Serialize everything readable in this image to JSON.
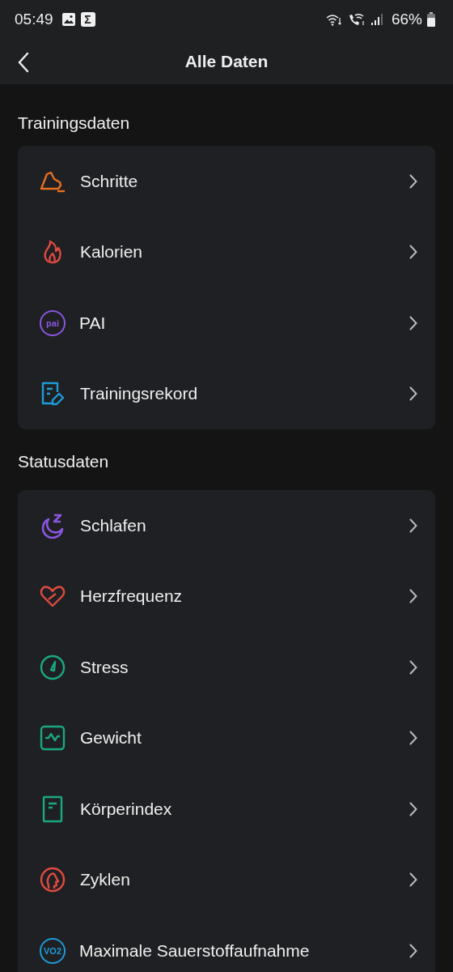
{
  "status_bar": {
    "time": "05:49",
    "notification_badge": "Σ",
    "battery": "66%"
  },
  "header": {
    "title": "Alle Daten"
  },
  "sections": [
    {
      "title": "Trainingsdaten",
      "items": [
        {
          "label": "Schritte",
          "kind": "shoe",
          "color": "#e8701f"
        },
        {
          "label": "Kalorien",
          "kind": "flame",
          "color": "#e04a3f"
        },
        {
          "label": "PAI",
          "kind": "badge",
          "color": "#8a56e0",
          "icon_text": "pai"
        },
        {
          "label": "Trainingsrekord",
          "kind": "record",
          "color": "#1f9bd8"
        }
      ]
    },
    {
      "title": "Statusdaten",
      "items": [
        {
          "label": "Schlafen",
          "kind": "sleep",
          "color": "#8a56e0"
        },
        {
          "label": "Herzfrequenz",
          "kind": "heart",
          "color": "#e04a3f"
        },
        {
          "label": "Stress",
          "kind": "gauge",
          "color": "#1aa882"
        },
        {
          "label": "Gewicht",
          "kind": "scale",
          "color": "#1aa882"
        },
        {
          "label": "Körperindex",
          "kind": "doc",
          "color": "#1aa882"
        },
        {
          "label": "Zyklen",
          "kind": "cycle",
          "color": "#e04a3f"
        },
        {
          "label": "Maximale Sauerstoffaufnahme",
          "kind": "badge",
          "color": "#1f9bd8",
          "icon_text": "VO2"
        }
      ]
    }
  ]
}
